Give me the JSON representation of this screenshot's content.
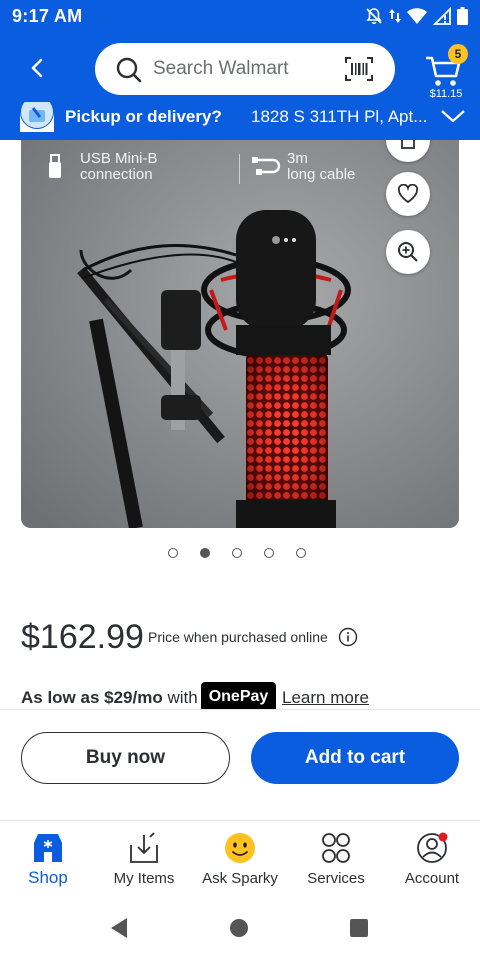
{
  "status_bar": {
    "time": "9:17 AM"
  },
  "header": {
    "search_placeholder": "Search Walmart",
    "cart_count": "5",
    "cart_total": "$11.15"
  },
  "pickup": {
    "label": "Pickup or delivery?",
    "address": "1828 S 311TH Pl, Apt..."
  },
  "gallery": {
    "feature_1_line_1": "USB Mini-B",
    "feature_1_line_2": "connection",
    "feature_2_line_1": "3m",
    "feature_2_line_2": "long cable",
    "dots_count": 5,
    "active_dot_index": 1
  },
  "product": {
    "price": "$162.99",
    "price_note": "Price when purchased online",
    "installment_prefix": "As low as $29/mo",
    "installment_with": " with",
    "onepay_label": "OnePay",
    "learn_more": "Learn more"
  },
  "actions": {
    "buy_now": "Buy now",
    "add_to_cart": "Add to cart"
  },
  "bottom_nav": {
    "items": [
      {
        "label": "Shop",
        "icon": "shop-icon",
        "active": true
      },
      {
        "label": "My Items",
        "icon": "my-items-icon",
        "active": false
      },
      {
        "label": "Ask Sparky",
        "icon": "sparky-icon",
        "active": false
      },
      {
        "label": "Services",
        "icon": "services-icon",
        "active": false
      },
      {
        "label": "Account",
        "icon": "account-icon",
        "active": false
      }
    ]
  },
  "colors": {
    "brand_blue": "#0a5dde",
    "cart_badge": "#ffc220",
    "text_dark": "#2e2f32"
  }
}
